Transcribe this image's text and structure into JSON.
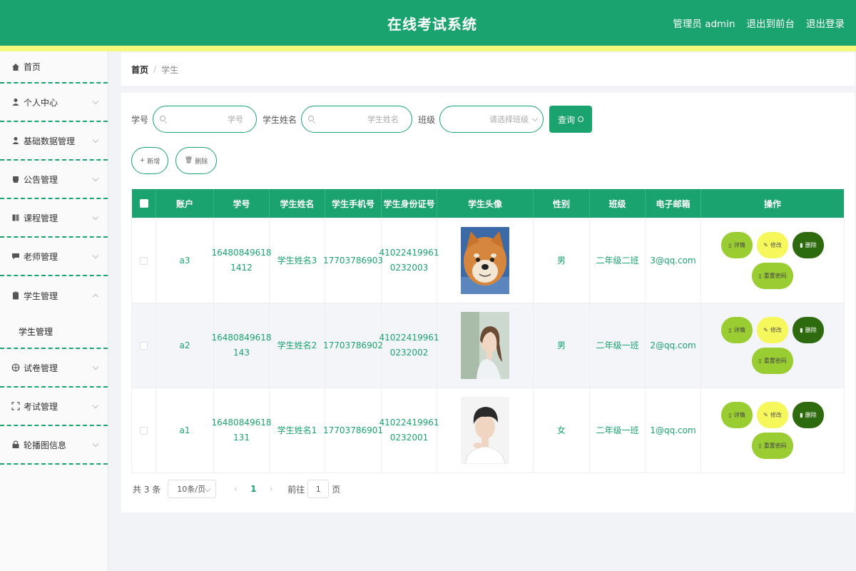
{
  "header": {
    "title": "在线考试系统",
    "admin_label": "管理员 admin",
    "to_front_label": "退出到前台",
    "logout_label": "退出登录"
  },
  "sidebar": {
    "items": [
      {
        "label": "首页",
        "icon": "home-icon"
      },
      {
        "label": "个人中心",
        "icon": "user-icon"
      },
      {
        "label": "基础数据管理",
        "icon": "user-icon"
      },
      {
        "label": "公告管理",
        "icon": "note-icon"
      },
      {
        "label": "课程管理",
        "icon": "book-icon"
      },
      {
        "label": "老师管理",
        "icon": "chat-icon"
      },
      {
        "label": "学生管理",
        "icon": "clipboard-icon"
      },
      {
        "label": "试卷管理",
        "icon": "target-icon"
      },
      {
        "label": "考试管理",
        "icon": "frame-icon"
      },
      {
        "label": "轮播图信息",
        "icon": "lock-icon"
      }
    ],
    "submenu_label": "学生管理"
  },
  "breadcrumb": {
    "home": "首页",
    "separator": "/",
    "current": "学生"
  },
  "search": {
    "student_no_label": "学号",
    "student_no_placeholder": "学号",
    "student_name_label": "学生姓名",
    "student_name_placeholder": "学生姓名",
    "class_label": "班级",
    "class_placeholder": "请选择班级",
    "query_label": "查询"
  },
  "actions": {
    "add_label": "新增",
    "delete_label": "删除"
  },
  "table": {
    "headers": [
      "账户",
      "学号",
      "学生姓名",
      "学生手机号",
      "学生身份证号",
      "学生头像",
      "性别",
      "班级",
      "电子邮箱",
      "操作"
    ],
    "rows": [
      {
        "account": "a3",
        "student_no_line1": "16480849618",
        "student_no_line2": "1412",
        "name": "学生姓名3",
        "phone": "17703786903",
        "id_line1": "41022419961",
        "id_line2": "0232003",
        "gender": "男",
        "class": "二年级二班",
        "email": "3@qq.com",
        "avatar": "dog-photo"
      },
      {
        "account": "a2",
        "student_no_line1": "16480849618",
        "student_no_line2": "143",
        "name": "学生姓名2",
        "phone": "17703786902",
        "id_line1": "41022419961",
        "id_line2": "0232002",
        "gender": "男",
        "class": "二年级一班",
        "email": "2@qq.com",
        "avatar": "girl-photo"
      },
      {
        "account": "a1",
        "student_no_line1": "16480849618",
        "student_no_line2": "131",
        "name": "学生姓名1",
        "phone": "17703786901",
        "id_line1": "41022419961",
        "id_line2": "0232001",
        "gender": "女",
        "class": "二年级一班",
        "email": "1@qq.com",
        "avatar": "boy-photo"
      }
    ],
    "op_labels": {
      "detail": "详情",
      "edit": "修改",
      "delete": "删除",
      "reset": "重置密码"
    }
  },
  "pager": {
    "total": "共 3 条",
    "page_size": "10条/页",
    "current_page": "1",
    "goto_prefix": "前往",
    "goto_value": "1",
    "goto_suffix": "页"
  },
  "colors": {
    "primary": "#1ba36f",
    "stripe": "#f5f87a",
    "detail_btn": "#9acd32",
    "edit_btn": "#f6f75a",
    "delete_btn": "#2e6b0e"
  }
}
